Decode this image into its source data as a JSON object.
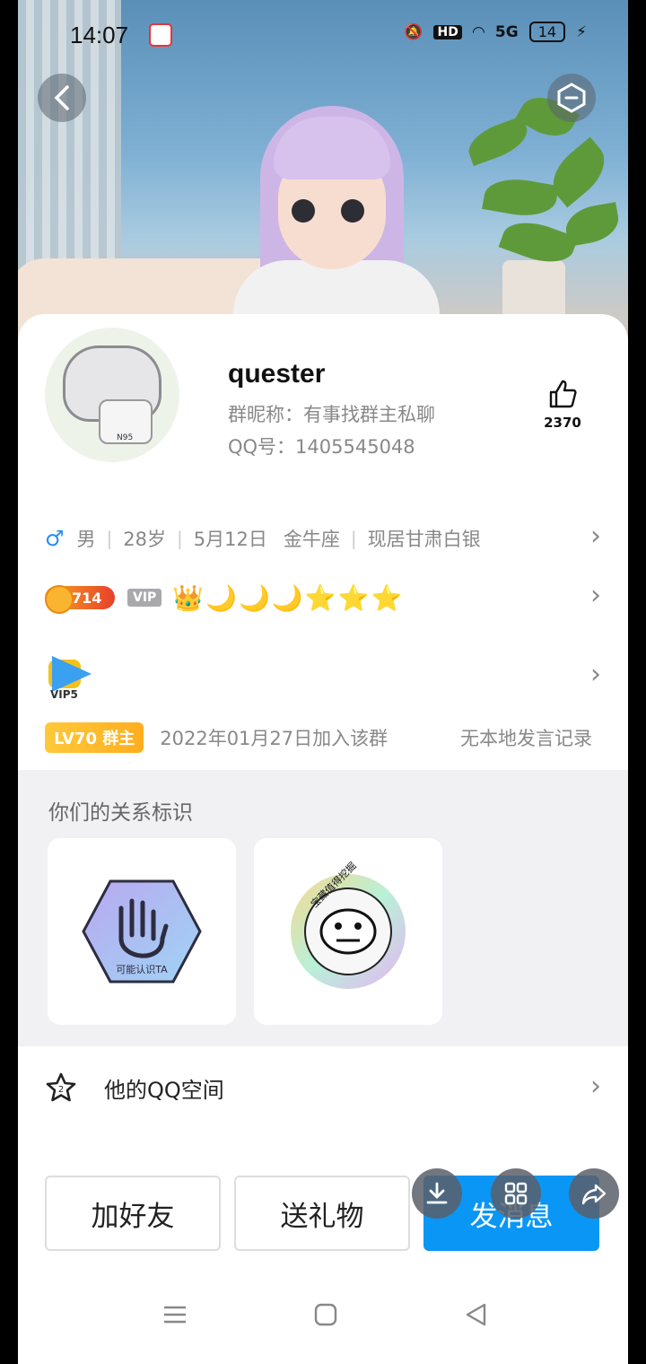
{
  "status_bar": {
    "time": "14:07",
    "network": "HD",
    "signal": "5G",
    "battery": "14"
  },
  "profile": {
    "name": "quester",
    "group_nickname": "群昵称：有事找群主私聊",
    "qq_number": "QQ号：1405545048",
    "likes": "2370",
    "avatar_text": "N95"
  },
  "info": {
    "gender_symbol": "♂",
    "gender": "男",
    "age": "28岁",
    "birthday": "5月12日",
    "zodiac": "金牛座",
    "location": "现居甘肃白银"
  },
  "level": {
    "coin_value": "714",
    "vip_label": "VIP",
    "icons": "👑🌙🌙🌙⭐⭐⭐"
  },
  "video_vip": {
    "label": "VIP5"
  },
  "group": {
    "level_badge": "LV70 群主",
    "join_text": "2022年01月27日加入该群",
    "history_text": "无本地发言记录"
  },
  "relationship": {
    "title": "你们的关系标识",
    "badges": [
      {
        "label": "可能认识TA"
      },
      {
        "label": "宝藏值得挖掘"
      }
    ]
  },
  "qq_zone": {
    "label": "他的QQ空间"
  },
  "actions": {
    "add_friend": "加好友",
    "send_gift": "送礼物",
    "send_message": "发消息"
  }
}
